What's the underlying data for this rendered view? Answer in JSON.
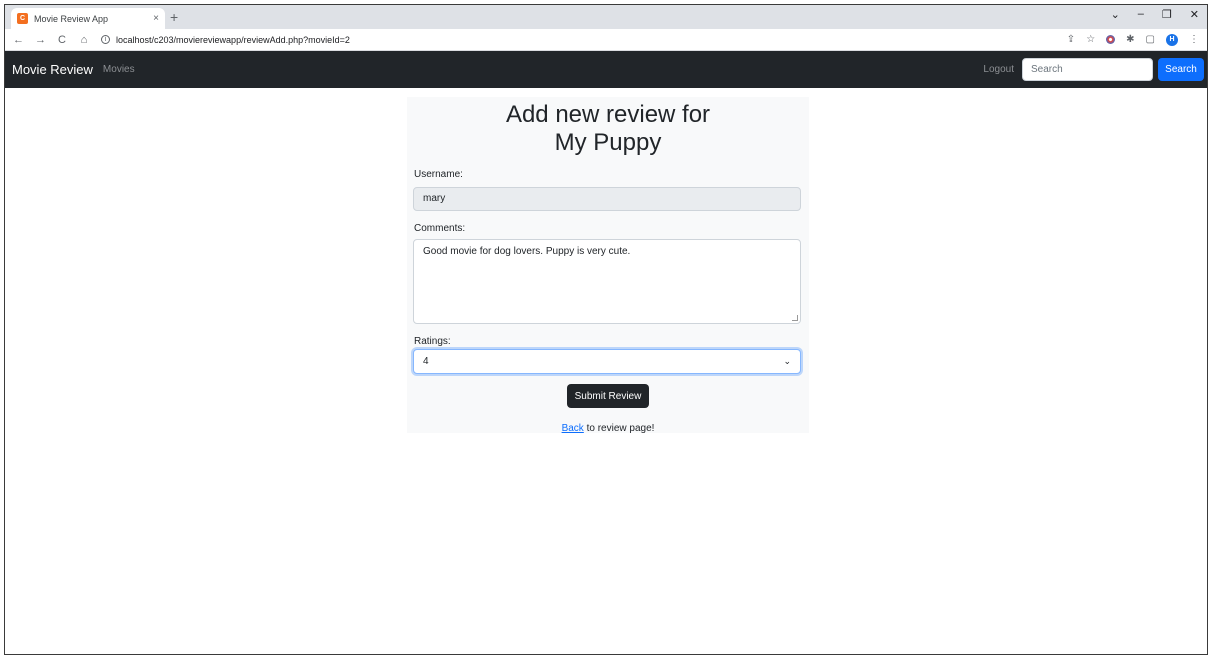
{
  "browser": {
    "tab_title": "Movie Review App",
    "favicon_label": "C",
    "tab_close": "×",
    "new_tab": "+",
    "url": "localhost/c203/moviereviewapp/reviewAdd.php?movieId=2",
    "avatar_initial": "H"
  },
  "navbar": {
    "brand": "Movie Review",
    "movies_link": "Movies",
    "logout_link": "Logout",
    "search_placeholder": "Search",
    "search_button": "Search"
  },
  "form": {
    "heading_line1": "Add new review for",
    "heading_line2": "My Puppy",
    "username_label": "Username:",
    "username_value": "mary",
    "comments_label": "Comments:",
    "comments_value": "Good movie for dog lovers. Puppy is very cute.",
    "ratings_label": "Ratings:",
    "ratings_value": "4",
    "submit_label": "Submit Review",
    "back_link": "Back",
    "back_text": " to review page!"
  },
  "colors": {
    "navbar_bg": "#212529",
    "primary": "#0d6efd",
    "card_bg": "#f8f9fa"
  }
}
